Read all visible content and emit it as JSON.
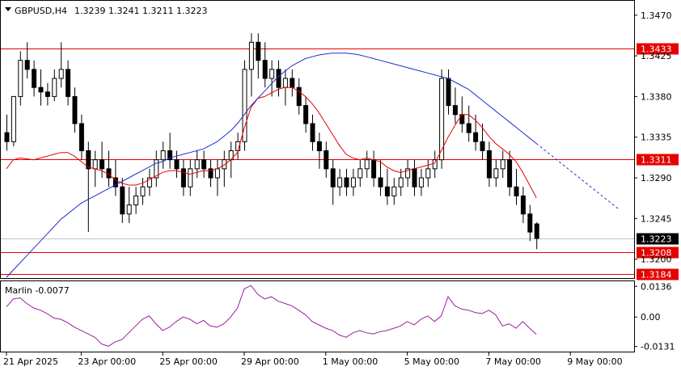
{
  "header": {
    "symbol": "GBPUSD,H4",
    "ohlc": "1.3239 1.3241 1.3211 1.3223"
  },
  "chart_data": {
    "type": "candlestick",
    "price_axis": {
      "ylim": [
        1.318,
        1.3485
      ],
      "ticks": [
        "1.3470",
        "1.3425",
        "1.3380",
        "1.3335",
        "1.3290",
        "1.3245",
        "1.3200"
      ]
    },
    "x_labels": [
      {
        "label": "21 Apr 2025",
        "index": 0
      },
      {
        "label": "23 Apr 00:00",
        "index": 11
      },
      {
        "label": "25 Apr 00:00",
        "index": 23
      },
      {
        "label": "29 Apr 00:00",
        "index": 35
      },
      {
        "label": "1 May 00:00",
        "index": 47
      },
      {
        "label": "5 May 00:00",
        "index": 59
      },
      {
        "label": "7 May 00:00",
        "index": 71
      },
      {
        "label": "9 May 00:00",
        "index": 83
      }
    ],
    "hlines": [
      {
        "value": 1.3433,
        "label": "1.3433",
        "color": "#e60000"
      },
      {
        "value": 1.3311,
        "label": "1.3311",
        "color": "#e60000"
      },
      {
        "value": 1.3208,
        "label": "1.3208",
        "color": "#e60000"
      },
      {
        "value": 1.3184,
        "label": "1.3184",
        "color": "#e60000"
      }
    ],
    "current_price": {
      "value": 1.3223,
      "label": "1.3223"
    },
    "candles": [
      [
        1.334,
        1.336,
        1.332,
        1.333
      ],
      [
        1.333,
        1.338,
        1.3325,
        1.338
      ],
      [
        1.338,
        1.343,
        1.337,
        1.342
      ],
      [
        1.342,
        1.344,
        1.34,
        1.341
      ],
      [
        1.341,
        1.342,
        1.338,
        1.339
      ],
      [
        1.339,
        1.341,
        1.337,
        1.3385
      ],
      [
        1.3385,
        1.3395,
        1.337,
        1.338
      ],
      [
        1.338,
        1.341,
        1.3375,
        1.34
      ],
      [
        1.34,
        1.344,
        1.339,
        1.341
      ],
      [
        1.341,
        1.342,
        1.337,
        1.338
      ],
      [
        1.338,
        1.339,
        1.334,
        1.335
      ],
      [
        1.335,
        1.336,
        1.331,
        1.332
      ],
      [
        1.332,
        1.333,
        1.323,
        1.33
      ],
      [
        1.33,
        1.332,
        1.328,
        1.331
      ],
      [
        1.331,
        1.333,
        1.329,
        1.33
      ],
      [
        1.33,
        1.332,
        1.328,
        1.329
      ],
      [
        1.329,
        1.331,
        1.327,
        1.328
      ],
      [
        1.328,
        1.329,
        1.324,
        1.325
      ],
      [
        1.325,
        1.328,
        1.324,
        1.326
      ],
      [
        1.326,
        1.328,
        1.325,
        1.327
      ],
      [
        1.327,
        1.329,
        1.326,
        1.328
      ],
      [
        1.328,
        1.33,
        1.327,
        1.329
      ],
      [
        1.329,
        1.332,
        1.328,
        1.331
      ],
      [
        1.331,
        1.333,
        1.33,
        1.332
      ],
      [
        1.332,
        1.334,
        1.33,
        1.331
      ],
      [
        1.331,
        1.332,
        1.329,
        1.33
      ],
      [
        1.33,
        1.331,
        1.327,
        1.328
      ],
      [
        1.328,
        1.331,
        1.327,
        1.33
      ],
      [
        1.33,
        1.332,
        1.329,
        1.331
      ],
      [
        1.331,
        1.332,
        1.329,
        1.33
      ],
      [
        1.33,
        1.331,
        1.328,
        1.329
      ],
      [
        1.329,
        1.331,
        1.327,
        1.33
      ],
      [
        1.33,
        1.332,
        1.328,
        1.331
      ],
      [
        1.331,
        1.333,
        1.329,
        1.332
      ],
      [
        1.332,
        1.334,
        1.331,
        1.333
      ],
      [
        1.333,
        1.342,
        1.332,
        1.341
      ],
      [
        1.341,
        1.345,
        1.338,
        1.344
      ],
      [
        1.344,
        1.345,
        1.34,
        1.342
      ],
      [
        1.342,
        1.344,
        1.339,
        1.34
      ],
      [
        1.34,
        1.342,
        1.338,
        1.341
      ],
      [
        1.341,
        1.342,
        1.338,
        1.339
      ],
      [
        1.339,
        1.341,
        1.337,
        1.34
      ],
      [
        1.34,
        1.341,
        1.338,
        1.339
      ],
      [
        1.339,
        1.34,
        1.336,
        1.337
      ],
      [
        1.337,
        1.338,
        1.334,
        1.335
      ],
      [
        1.335,
        1.336,
        1.332,
        1.333
      ],
      [
        1.333,
        1.334,
        1.33,
        1.332
      ],
      [
        1.332,
        1.333,
        1.329,
        1.33
      ],
      [
        1.33,
        1.331,
        1.326,
        1.328
      ],
      [
        1.328,
        1.33,
        1.327,
        1.329
      ],
      [
        1.329,
        1.33,
        1.327,
        1.328
      ],
      [
        1.328,
        1.33,
        1.327,
        1.329
      ],
      [
        1.329,
        1.331,
        1.328,
        1.33
      ],
      [
        1.33,
        1.332,
        1.329,
        1.331
      ],
      [
        1.331,
        1.332,
        1.328,
        1.329
      ],
      [
        1.329,
        1.331,
        1.327,
        1.328
      ],
      [
        1.328,
        1.33,
        1.326,
        1.327
      ],
      [
        1.327,
        1.329,
        1.326,
        1.328
      ],
      [
        1.328,
        1.33,
        1.327,
        1.329
      ],
      [
        1.329,
        1.331,
        1.328,
        1.33
      ],
      [
        1.33,
        1.331,
        1.327,
        1.328
      ],
      [
        1.328,
        1.33,
        1.327,
        1.329
      ],
      [
        1.329,
        1.331,
        1.328,
        1.33
      ],
      [
        1.33,
        1.332,
        1.329,
        1.331
      ],
      [
        1.331,
        1.341,
        1.33,
        1.34
      ],
      [
        1.34,
        1.341,
        1.336,
        1.337
      ],
      [
        1.337,
        1.339,
        1.335,
        1.336
      ],
      [
        1.336,
        1.338,
        1.334,
        1.335
      ],
      [
        1.335,
        1.337,
        1.333,
        1.334
      ],
      [
        1.334,
        1.336,
        1.332,
        1.333
      ],
      [
        1.333,
        1.335,
        1.331,
        1.332
      ],
      [
        1.332,
        1.333,
        1.328,
        1.329
      ],
      [
        1.329,
        1.331,
        1.328,
        1.33
      ],
      [
        1.33,
        1.332,
        1.329,
        1.331
      ],
      [
        1.331,
        1.332,
        1.327,
        1.328
      ],
      [
        1.328,
        1.33,
        1.326,
        1.327
      ],
      [
        1.327,
        1.328,
        1.324,
        1.325
      ],
      [
        1.325,
        1.326,
        1.322,
        1.323
      ],
      [
        1.3239,
        1.3241,
        1.3211,
        1.3223
      ]
    ],
    "ma_red": [
      1.33,
      1.331,
      1.3312,
      1.3311,
      1.331,
      1.3312,
      1.3314,
      1.3316,
      1.3318,
      1.3318,
      1.3314,
      1.3308,
      1.3302,
      1.33,
      1.3298,
      1.3294,
      1.3288,
      1.3284,
      1.3282,
      1.3282,
      1.3284,
      1.3288,
      1.3292,
      1.3296,
      1.3298,
      1.3298,
      1.3296,
      1.3294,
      1.3296,
      1.3298,
      1.3298,
      1.33,
      1.3304,
      1.331,
      1.3318,
      1.3345,
      1.3368,
      1.3378,
      1.338,
      1.3384,
      1.3388,
      1.339,
      1.339,
      1.3386,
      1.338,
      1.3372,
      1.3362,
      1.335,
      1.3338,
      1.3326,
      1.3316,
      1.3312,
      1.331,
      1.3312,
      1.331,
      1.3308,
      1.3302,
      1.3298,
      1.3296,
      1.3298,
      1.33,
      1.3302,
      1.3304,
      1.3306,
      1.332,
      1.3335,
      1.3348,
      1.336,
      1.336,
      1.3354,
      1.3346,
      1.3336,
      1.3328,
      1.3322,
      1.3316,
      1.3308,
      1.3296,
      1.3282,
      1.3268
    ],
    "ma_blue": [
      1.318,
      1.3188,
      1.3196,
      1.3204,
      1.3212,
      1.322,
      1.3228,
      1.3236,
      1.3244,
      1.325,
      1.3256,
      1.3262,
      1.3266,
      1.327,
      1.3274,
      1.3278,
      1.3282,
      1.3286,
      1.329,
      1.3294,
      1.3298,
      1.3302,
      1.3306,
      1.3308,
      1.3312,
      1.3314,
      1.3316,
      1.3318,
      1.332,
      1.3322,
      1.3326,
      1.333,
      1.3336,
      1.3342,
      1.335,
      1.336,
      1.337,
      1.3378,
      1.3386,
      1.3394,
      1.3402,
      1.3408,
      1.3414,
      1.3418,
      1.3422,
      1.3424,
      1.3426,
      1.3427,
      1.3428,
      1.3428,
      1.3428,
      1.3427,
      1.3426,
      1.3424,
      1.3422,
      1.342,
      1.3418,
      1.3416,
      1.3414,
      1.3412,
      1.341,
      1.3408,
      1.3406,
      1.3404,
      1.3402,
      1.34,
      1.3396,
      1.3392,
      1.3388,
      1.3382,
      1.3376,
      1.337,
      1.3364,
      1.3358,
      1.3352,
      1.3346,
      1.334,
      1.3334,
      1.3328
    ],
    "ma_blue_projection": [
      1.3322,
      1.3316,
      1.331,
      1.3304,
      1.3298,
      1.3292,
      1.3286,
      1.328,
      1.3274,
      1.3268,
      1.3262,
      1.3256
    ],
    "indicator": {
      "label": "Marlin -0.0077",
      "ylim": [
        -0.015,
        0.0155
      ],
      "ticks": [
        "0.0136",
        "0.00",
        "-0.0131"
      ],
      "values": [
        0.0045,
        0.008,
        0.0085,
        0.006,
        0.004,
        0.003,
        0.0015,
        -0.0005,
        -0.001,
        -0.0025,
        -0.0045,
        -0.006,
        -0.0075,
        -0.009,
        -0.012,
        -0.013,
        -0.011,
        -0.01,
        -0.007,
        -0.004,
        -0.001,
        0.0005,
        -0.003,
        -0.006,
        -0.0045,
        -0.002,
        0.0,
        -0.001,
        -0.003,
        -0.0015,
        -0.004,
        -0.0045,
        -0.003,
        0.0,
        0.004,
        0.0125,
        0.014,
        0.01,
        0.008,
        0.009,
        0.007,
        0.006,
        0.005,
        0.003,
        0.001,
        -0.002,
        -0.0035,
        -0.005,
        -0.006,
        -0.008,
        -0.009,
        -0.007,
        -0.006,
        -0.007,
        -0.0075,
        -0.0065,
        -0.006,
        -0.005,
        -0.004,
        -0.002,
        -0.0035,
        -0.001,
        0.0005,
        -0.002,
        0.0005,
        0.009,
        0.005,
        0.0035,
        0.003,
        0.002,
        0.0015,
        0.003,
        0.001,
        -0.004,
        -0.003,
        -0.005,
        -0.002,
        -0.005,
        -0.0077
      ]
    }
  },
  "colors": {
    "grid_border": "#000000",
    "candle": "#000000",
    "ma_red": "#e60000",
    "ma_blue": "#1f2fd0",
    "indicator": "#9b1fa0",
    "hline": "#e60000",
    "current_bg": "#000000",
    "current_fg": "#ffffff"
  }
}
